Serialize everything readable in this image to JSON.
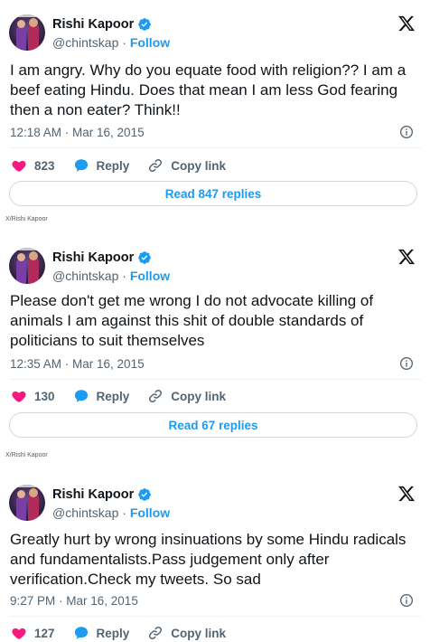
{
  "tweets": [
    {
      "author": {
        "name": "Rishi Kapoor",
        "handle": "@chintskap",
        "separator": " · ",
        "follow_label": "Follow"
      },
      "text": "I am angry. Why do you  equate food with religion?? I am a beef eating Hindu. Does that mean I am less God fearing then a non eater? Think!!",
      "timestamp": "12:18 AM · Mar 16, 2015",
      "likes": "823",
      "reply_label": "Reply",
      "copy_link_label": "Copy link",
      "read_replies_label": "Read 847 replies"
    },
    {
      "author": {
        "name": "Rishi Kapoor",
        "handle": "@chintskap",
        "separator": " · ",
        "follow_label": "Follow"
      },
      "text": "Please don't get me wrong I do not advocate killing of animals I am against this shit of double standards of politicians to suit themselves",
      "timestamp": "12:35 AM · Mar 16, 2015",
      "likes": "130",
      "reply_label": "Reply",
      "copy_link_label": "Copy link",
      "read_replies_label": "Read 67 replies"
    },
    {
      "author": {
        "name": "Rishi Kapoor",
        "handle": "@chintskap",
        "separator": " · ",
        "follow_label": "Follow"
      },
      "text": "Greatly hurt by wrong insinuations by some Hindu radicals and fundamentalists.Pass judgement only after verification.Check my tweets. So sad",
      "timestamp": "9:27 PM · Mar 16, 2015",
      "likes": "127",
      "reply_label": "Reply",
      "copy_link_label": "Copy link"
    }
  ],
  "credits": [
    "X/Rishi Kapoor",
    "X/Rishi Kapoor"
  ],
  "icons": {
    "verified": "verified-badge-icon",
    "platform": "x-logo-icon",
    "info": "info-icon",
    "like": "heart-icon",
    "reply": "reply-bubble-icon",
    "copy_link": "link-icon"
  },
  "colors": {
    "accent": "#1d9bf0",
    "like": "#f91880",
    "text": "#0f1419",
    "secondary": "#536471",
    "border": "#cfd9de"
  }
}
